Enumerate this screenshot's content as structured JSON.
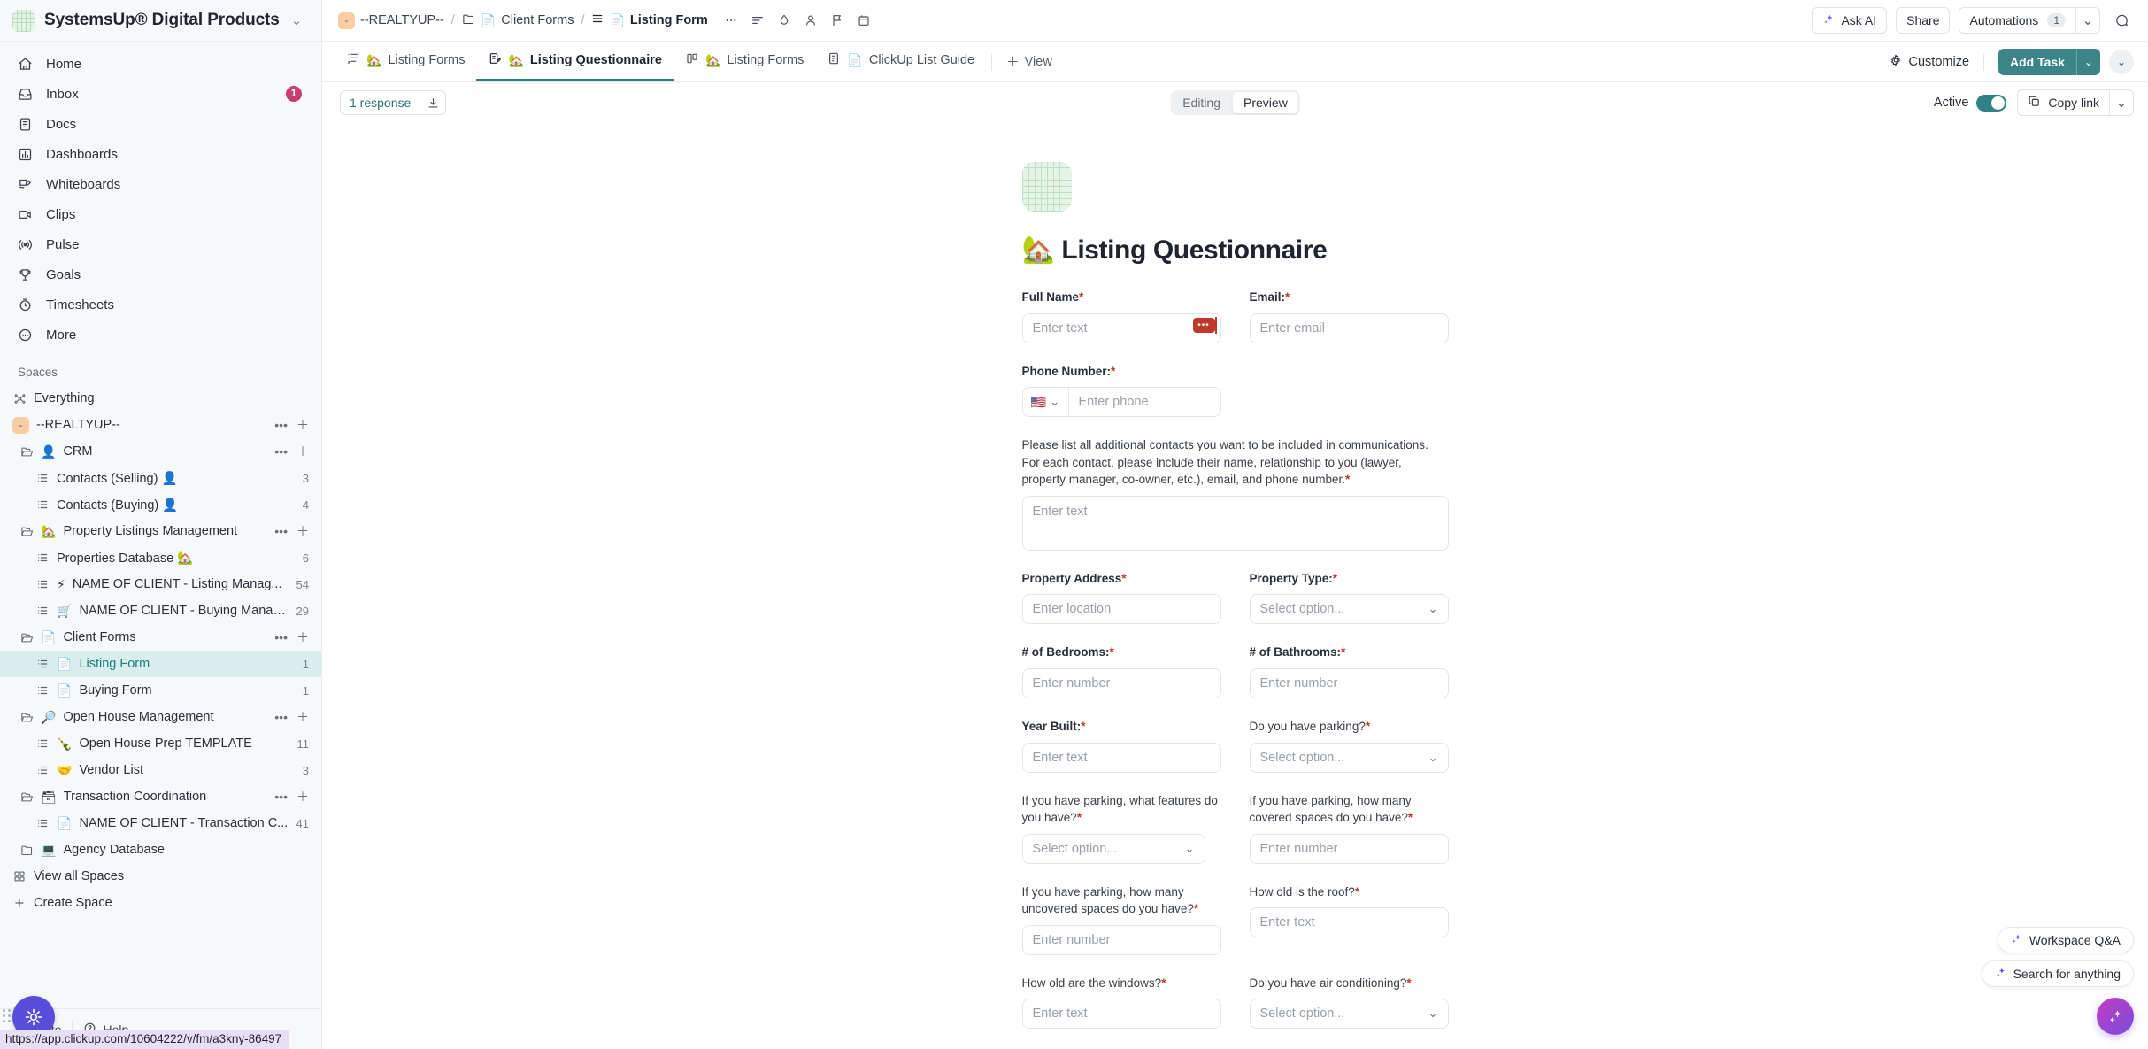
{
  "workspace": {
    "name": "SystemsUp® Digital Products",
    "caret": "chevron-down"
  },
  "nav": [
    {
      "label": "Home",
      "icon": "home-icon",
      "badge": ""
    },
    {
      "label": "Inbox",
      "icon": "inbox-icon",
      "badge": "1"
    },
    {
      "label": "Docs",
      "icon": "doc-icon",
      "badge": ""
    },
    {
      "label": "Dashboards",
      "icon": "dashboard-icon",
      "badge": ""
    },
    {
      "label": "Whiteboards",
      "icon": "whiteboard-icon",
      "badge": ""
    },
    {
      "label": "Clips",
      "icon": "clip-icon",
      "badge": ""
    },
    {
      "label": "Pulse",
      "icon": "pulse-icon",
      "badge": ""
    },
    {
      "label": "Goals",
      "icon": "goal-icon",
      "badge": ""
    },
    {
      "label": "Timesheets",
      "icon": "timesheet-icon",
      "badge": ""
    },
    {
      "label": "More",
      "icon": "more-icon",
      "badge": ""
    }
  ],
  "spaces": {
    "title": "Spaces",
    "everything": "Everything",
    "space_name": "--REALTYUP--",
    "space_badge": "-",
    "items": [
      {
        "label": "CRM",
        "emoji": "👤",
        "count": "",
        "indent": 1,
        "type": "folder"
      },
      {
        "label": "Contacts (Selling) 👤",
        "emoji": "👤",
        "count": "3",
        "indent": 2,
        "type": "list"
      },
      {
        "label": "Contacts (Buying) 👤",
        "emoji": "👤",
        "count": "4",
        "indent": 2,
        "type": "list"
      },
      {
        "label": "Property Listings Management",
        "emoji": "🏡",
        "count": "",
        "indent": 1,
        "type": "folder"
      },
      {
        "label": "Properties Database 🏡",
        "emoji": "🏡",
        "count": "6",
        "indent": 2,
        "type": "list"
      },
      {
        "label": "NAME OF CLIENT - Listing Manag...",
        "emoji": "⚡",
        "count": "54",
        "indent": 2,
        "type": "list"
      },
      {
        "label": "NAME OF CLIENT - Buying Manag...",
        "emoji": "🛒",
        "count": "29",
        "indent": 2,
        "type": "list"
      },
      {
        "label": "Client Forms",
        "emoji": "📄",
        "count": "",
        "indent": 1,
        "type": "folder"
      },
      {
        "label": "Listing Form",
        "emoji": "📄",
        "count": "1",
        "indent": 2,
        "type": "list",
        "selected": true
      },
      {
        "label": "Buying Form",
        "emoji": "📄",
        "count": "1",
        "indent": 2,
        "type": "list"
      },
      {
        "label": "Open House Management",
        "emoji": "🔎",
        "count": "",
        "indent": 1,
        "type": "folder"
      },
      {
        "label": "Open House Prep TEMPLATE",
        "emoji": "🍾",
        "count": "11",
        "indent": 2,
        "type": "list"
      },
      {
        "label": "Vendor List",
        "emoji": "🤝",
        "count": "3",
        "indent": 2,
        "type": "list"
      },
      {
        "label": "Transaction Coordination",
        "emoji": "🗃",
        "count": "",
        "indent": 1,
        "type": "folder"
      },
      {
        "label": "NAME OF CLIENT - Transaction C...",
        "emoji": "📄",
        "count": "41",
        "indent": 2,
        "type": "list"
      },
      {
        "label": "Agency Database",
        "emoji": "💻",
        "count": "",
        "indent": 1,
        "type": "folder-closed"
      }
    ],
    "view_all": "View all Spaces",
    "create_space": "Create Space"
  },
  "sidebar_footer": {
    "invite": "Invite",
    "help": "Help"
  },
  "status_url": "https://app.clickup.com/10604222/v/fm/a3kny-86497",
  "breadcrumbs": {
    "space": "--REALTYUP--",
    "space_badge": "-",
    "folder": "Client Forms",
    "folder_emoji": "📄",
    "list": "Listing Form",
    "list_emoji": "📄",
    "icons": [
      "ellipsis-icon",
      "sort-icon",
      "droplet-icon",
      "person-icon",
      "flag-icon",
      "calendar-icon"
    ]
  },
  "topbar_actions": {
    "ask_ai": "Ask AI",
    "share": "Share",
    "automations": "Automations",
    "automations_count": "1",
    "notifications_icon": "bell-icon"
  },
  "tabs": [
    {
      "label": "Listing Forms",
      "icon": "list-view-icon",
      "emoji": "🏡",
      "active": false
    },
    {
      "label": "Listing Questionnaire",
      "icon": "form-view-icon",
      "emoji": "🏡",
      "active": true
    },
    {
      "label": "Listing Forms",
      "icon": "board-view-icon",
      "emoji": "🏡",
      "active": false
    },
    {
      "label": "ClickUp List Guide",
      "icon": "doc-view-icon",
      "emoji": "📄",
      "active": false
    }
  ],
  "tab_add": "View",
  "tab_right": {
    "customize": "Customize",
    "add_task": "Add Task"
  },
  "form_toolbar": {
    "responses": "1 response",
    "download_icon": "download-icon",
    "modes": [
      "Editing",
      "Preview"
    ],
    "active_mode": "Preview",
    "active_label": "Active",
    "active_on": true,
    "copy_link": "Copy link"
  },
  "form": {
    "title": "🏡 Listing Questionnaire",
    "fields": [
      {
        "label": "Full Name",
        "required": true,
        "placeholder": "Enter text",
        "type": "text",
        "col": "left",
        "cursor_badge": "•••"
      },
      {
        "label": "Email:",
        "required": true,
        "placeholder": "Enter email",
        "type": "text",
        "col": "right"
      },
      {
        "label": "Phone Number:",
        "required": true,
        "placeholder": "Enter phone",
        "type": "phone",
        "col": "left",
        "country": "🇺🇸"
      },
      {
        "label": "Please list all additional contacts you want to be included in communications. For each contact, please include their name, relationship to you (lawyer, property manager, co-owner, etc.), email, and phone number.",
        "required": true,
        "placeholder": "Enter text",
        "type": "textarea",
        "col": "full",
        "label_style": "normal"
      },
      {
        "label": "Property Address",
        "required": true,
        "placeholder": "Enter location",
        "type": "text",
        "col": "left"
      },
      {
        "label": "Property Type:",
        "required": true,
        "placeholder": "Select option...",
        "type": "select",
        "col": "right"
      },
      {
        "label": "# of Bedrooms:",
        "required": true,
        "placeholder": "Enter number",
        "type": "text",
        "col": "left"
      },
      {
        "label": "# of Bathrooms:",
        "required": true,
        "placeholder": "Enter number",
        "type": "text",
        "col": "right"
      },
      {
        "label": "Year Built:",
        "required": true,
        "placeholder": "Enter text",
        "type": "text",
        "col": "left"
      },
      {
        "label": "Do you have parking?",
        "required": true,
        "placeholder": "Select option...",
        "type": "select",
        "col": "right"
      },
      {
        "label": "If you have parking, what features do you have?",
        "required": true,
        "placeholder": "Select option...",
        "type": "select",
        "col": "left",
        "label_style": "normal"
      },
      {
        "label": "If you have parking, how many covered spaces do you have?",
        "required": true,
        "placeholder": "Enter number",
        "type": "text",
        "col": "right",
        "label_style": "normal"
      },
      {
        "label": "If you have parking, how many uncovered spaces do you have?",
        "required": true,
        "placeholder": "Enter number",
        "type": "text",
        "col": "left",
        "label_style": "normal"
      },
      {
        "label": "How old is the roof?",
        "required": true,
        "placeholder": "Enter text",
        "type": "text",
        "col": "right",
        "label_style": "normal"
      },
      {
        "label": "How old are the windows?",
        "required": true,
        "placeholder": "Enter text",
        "type": "text",
        "col": "left",
        "label_style": "normal"
      },
      {
        "label": "Do you have air conditioning?",
        "required": true,
        "placeholder": "Select option...",
        "type": "select",
        "col": "right",
        "label_style": "normal"
      }
    ]
  },
  "floaters": {
    "workspace_qa": "Workspace Q&A",
    "search_anything": "Search for anything",
    "fab_icon": "ai-sparkle-icon"
  },
  "colors": {
    "accent_teal": "#3b8487",
    "selected_row": "#d9eded",
    "badge_pink": "#c73e6e",
    "required_red": "#c0392b",
    "ai_purple": "#7b4ae0"
  }
}
